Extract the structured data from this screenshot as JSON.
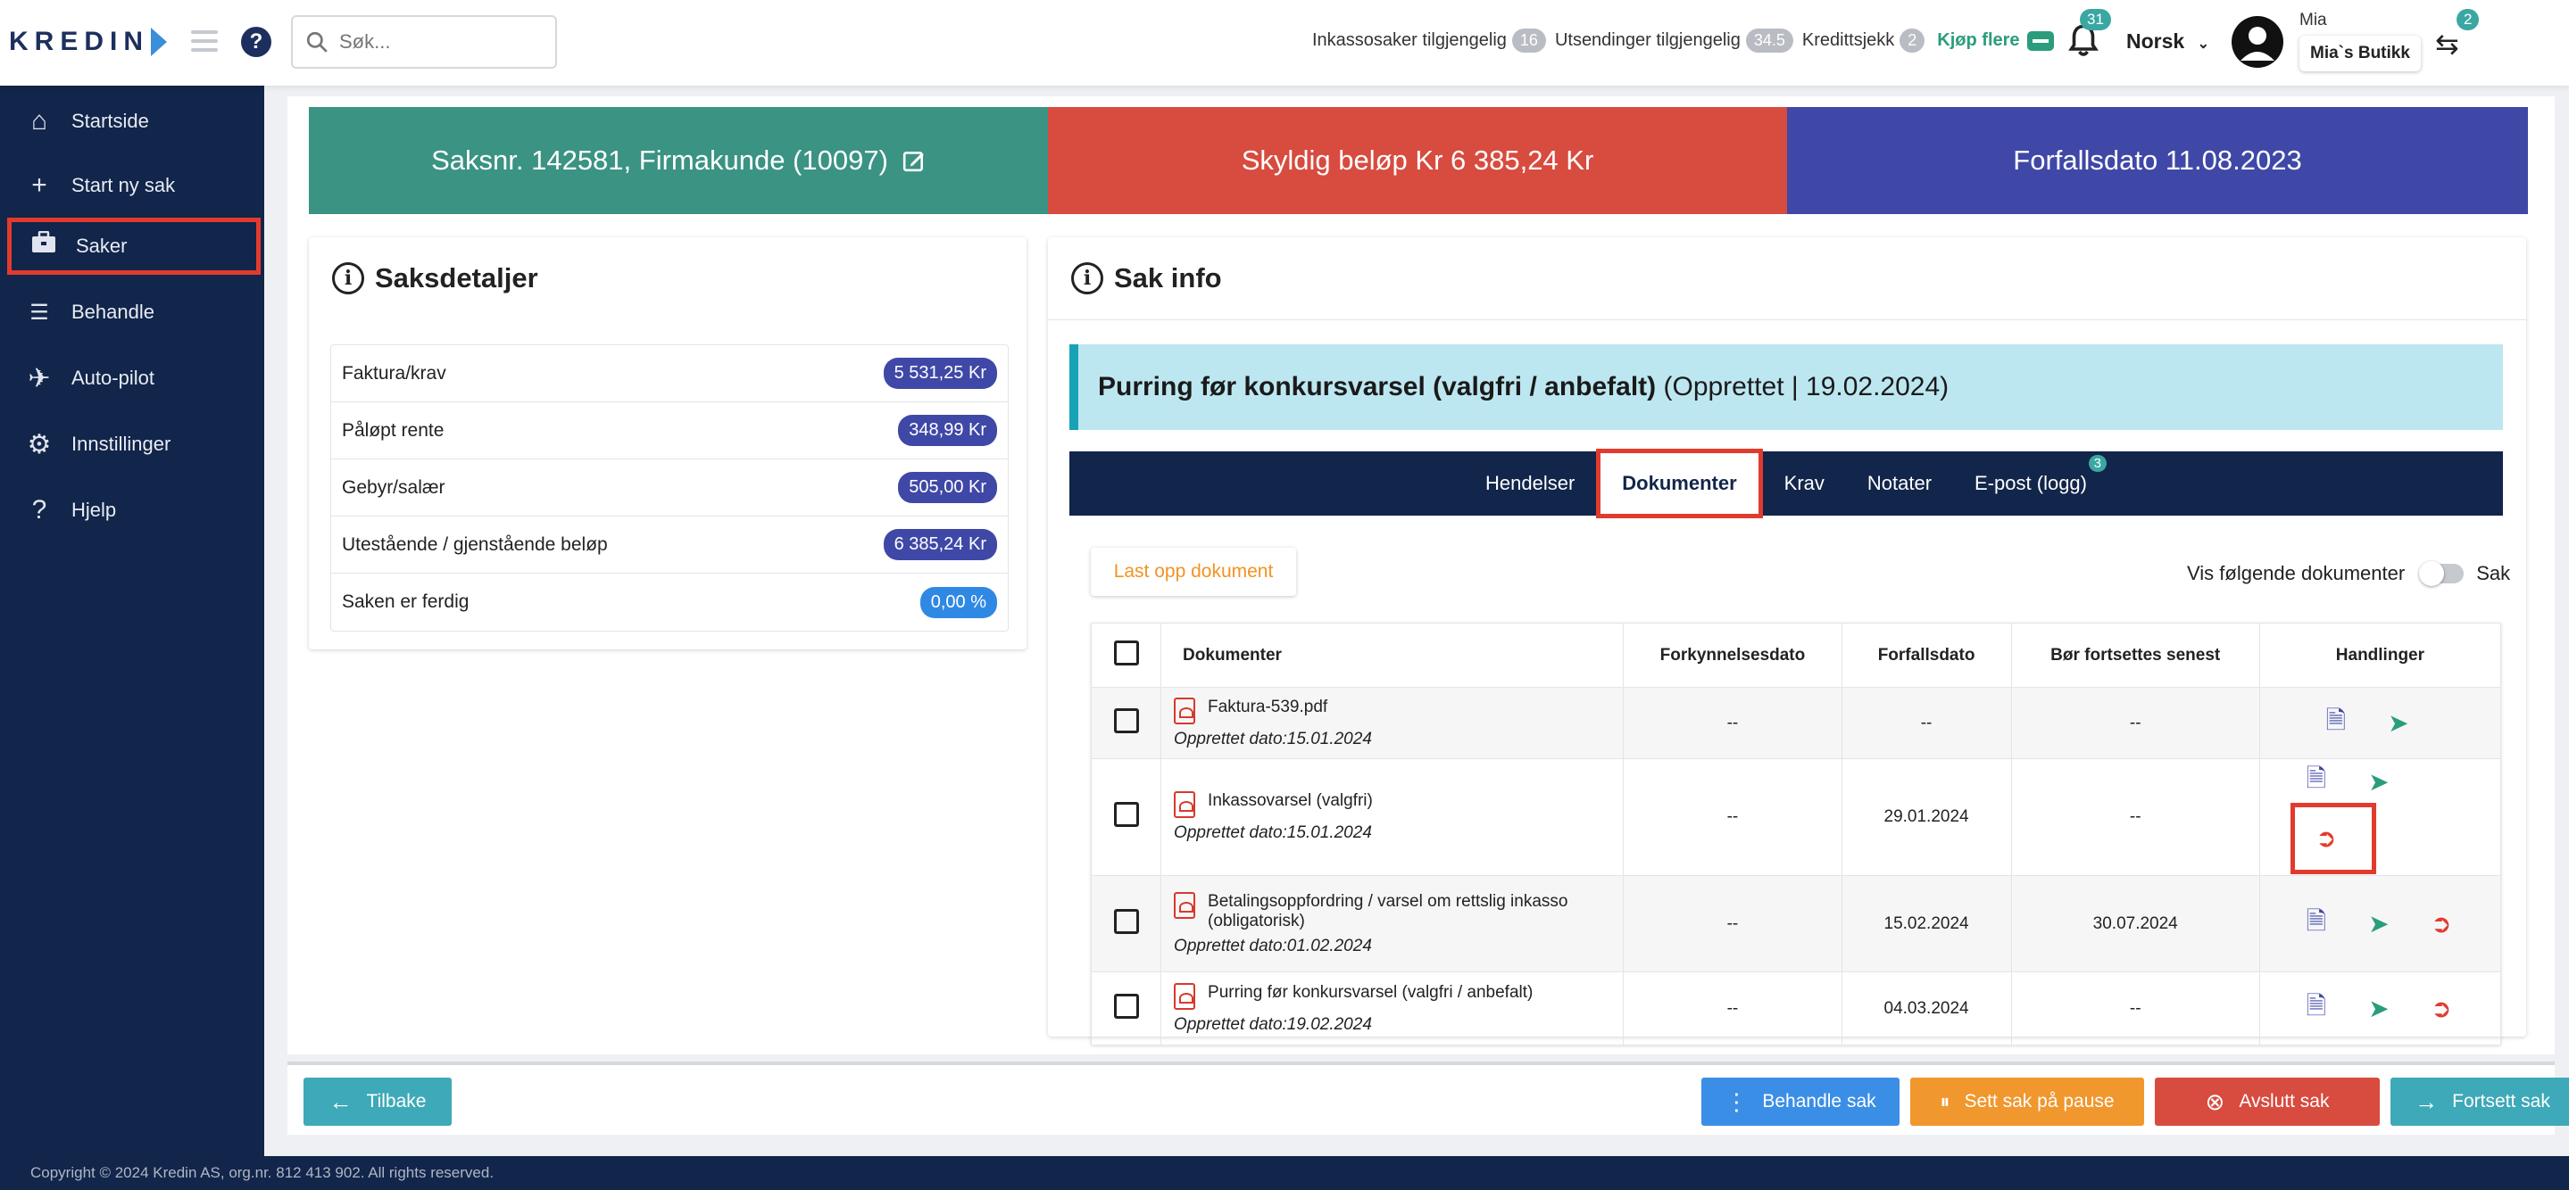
{
  "app": {
    "logo_text": "KREDIN"
  },
  "search": {
    "placeholder": "Søk..."
  },
  "stats": {
    "inkasso_label": "Inkassosaker tilgjengelig",
    "inkasso_count": "16",
    "utsend_label": "Utsendinger tilgjengelig",
    "utsend_count": "34.5",
    "kreditt_label": "Kredittsjekk",
    "kreditt_count": "2",
    "buy_label": "Kjøp flere"
  },
  "notifications": {
    "count": "31"
  },
  "language": {
    "label": "Norsk"
  },
  "user": {
    "name": "Mia",
    "store": "Mia`s Butikk",
    "switch_count": "2"
  },
  "sidebar": {
    "items": [
      {
        "label": "Startside",
        "icon": "home-icon"
      },
      {
        "label": "Start ny sak",
        "icon": "plus-icon"
      },
      {
        "label": "Saker",
        "icon": "briefcase-icon"
      },
      {
        "label": "Behandle",
        "icon": "checklist-icon"
      },
      {
        "label": "Auto-pilot",
        "icon": "plane-icon"
      },
      {
        "label": "Innstillinger",
        "icon": "gear-icon"
      },
      {
        "label": "Hjelp",
        "icon": "question-icon"
      }
    ]
  },
  "summary": {
    "case": "Saksnr. 142581,  Firmakunde (10097)",
    "owed": "Skyldig beløp Kr 6 385,24 Kr",
    "due": "Forfallsdato  11.08.2023"
  },
  "details": {
    "title": "Saksdetaljer",
    "rows": [
      {
        "label": "Faktura/krav",
        "value": "5 531,25 Kr"
      },
      {
        "label": "Påløpt rente",
        "value": "348,99 Kr"
      },
      {
        "label": "Gebyr/salær",
        "value": "505,00 Kr"
      },
      {
        "label": "Utestående / gjenstående beløp",
        "value": "6 385,24 Kr"
      },
      {
        "label": "Saken er ferdig",
        "value": "0,00 %"
      }
    ]
  },
  "info": {
    "title": "Sak info",
    "banner_bold": "Purring før konkursvarsel (valgfri / anbefalt)",
    "banner_rest": " (Opprettet | 19.02.2024)",
    "tabs": [
      "Hendelser",
      "Dokumenter",
      "Krav",
      "Notater",
      "E-post (logg)"
    ],
    "email_badge": "3",
    "upload_label": "Last opp dokument",
    "toggle_label": "Vis følgende dokumenter",
    "toggle_value": "Sak"
  },
  "table": {
    "headers": [
      "Dokumenter",
      "Forkynnelsesdato",
      "Forfallsdato",
      "Bør fortsettes senest",
      "Handlinger"
    ],
    "rows": [
      {
        "name": "Faktura-539.pdf",
        "created": "Opprettet dato:15.01.2024",
        "forkyn": "--",
        "forfall": "--",
        "senest": "--"
      },
      {
        "name": "Inkassovarsel (valgfri)",
        "created": "Opprettet dato:15.01.2024",
        "forkyn": "--",
        "forfall": "29.01.2024",
        "senest": "--"
      },
      {
        "name": "Betalingsoppfordring / varsel om rettslig inkasso (obligatorisk)",
        "created": "Opprettet dato:01.02.2024",
        "forkyn": "--",
        "forfall": "15.02.2024",
        "senest": "30.07.2024"
      },
      {
        "name": "Purring før konkursvarsel (valgfri / anbefalt)",
        "created": "Opprettet dato:19.02.2024",
        "forkyn": "--",
        "forfall": "04.03.2024",
        "senest": "--"
      }
    ]
  },
  "actions": {
    "back": "Tilbake",
    "process": "Behandle sak",
    "pause": "Sett sak på pause",
    "close": "Avslutt sak",
    "continue": "Fortsett sak"
  },
  "footer": {
    "text": "Copyright © 2024 Kredin AS, org.nr. 812 413 902. All rights reserved."
  },
  "colors": {
    "nav": "#12254a",
    "teal": "#3a9383",
    "red": "#d84b3f",
    "indigo": "#3f48a7",
    "highlight": "#e23b2e"
  }
}
